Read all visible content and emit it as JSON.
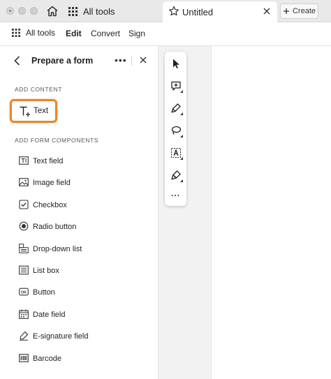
{
  "titlebar": {
    "all_tools_tab": "All tools",
    "document_tab": "Untitled",
    "create_label": "Create"
  },
  "menubar": {
    "items": [
      {
        "label": "All tools"
      },
      {
        "label": "Edit",
        "active": true
      },
      {
        "label": "Convert"
      },
      {
        "label": "Sign"
      }
    ]
  },
  "panel": {
    "title": "Prepare a form",
    "add_content_heading": "ADD CONTENT",
    "text_tool_label": "Text",
    "add_form_components_heading": "ADD FORM COMPONENTS",
    "components": [
      {
        "label": "Text field",
        "icon": "text-field-icon"
      },
      {
        "label": "Image field",
        "icon": "image-field-icon"
      },
      {
        "label": "Checkbox",
        "icon": "checkbox-icon"
      },
      {
        "label": "Radio button",
        "icon": "radio-button-icon"
      },
      {
        "label": "Drop-down list",
        "icon": "dropdown-list-icon"
      },
      {
        "label": "List box",
        "icon": "list-box-icon"
      },
      {
        "label": "Button",
        "icon": "ok-button-icon"
      },
      {
        "label": "Date field",
        "icon": "date-field-icon"
      },
      {
        "label": "E-signature field",
        "icon": "esignature-icon"
      },
      {
        "label": "Barcode",
        "icon": "barcode-icon"
      }
    ]
  },
  "toolbar": {
    "tools": [
      "select-arrow-icon",
      "add-comment-icon",
      "highlight-pen-icon",
      "lasso-icon",
      "text-select-icon",
      "signature-pen-icon"
    ],
    "more_label": "..."
  },
  "colors": {
    "highlight_border": "#e8872b",
    "canvas_background": "#f2f2f2",
    "titlebar_background": "#e9e9e9"
  }
}
